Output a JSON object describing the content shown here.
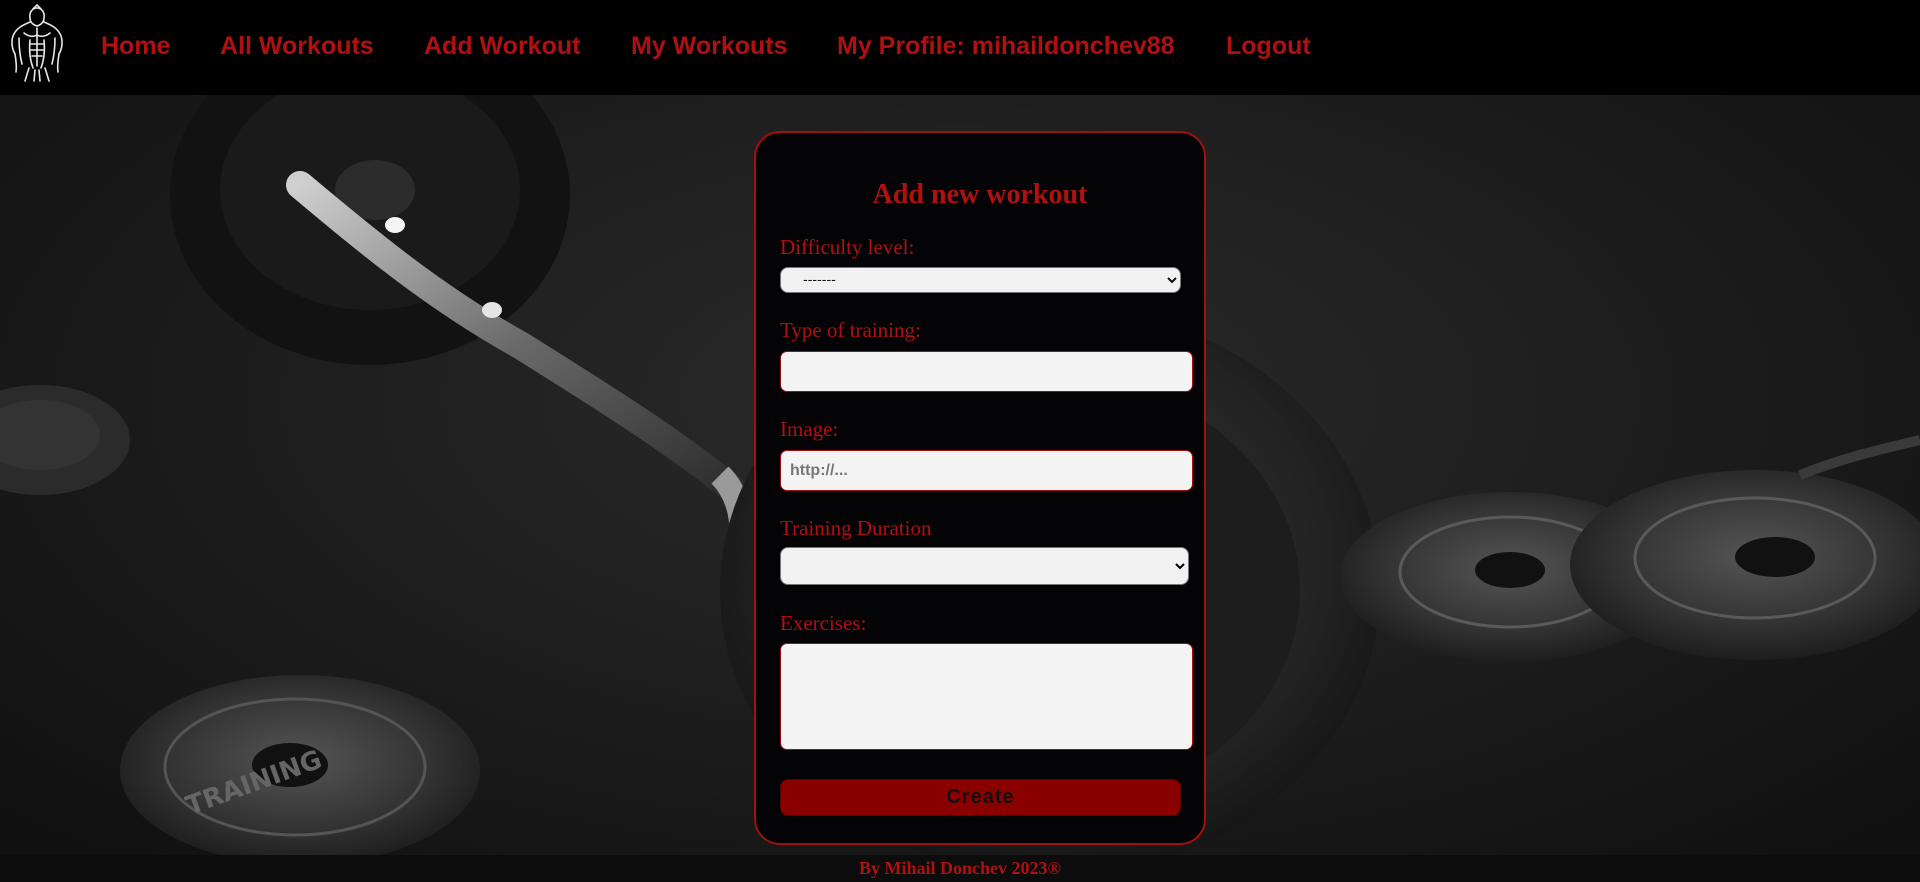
{
  "nav": {
    "logo_icon": "bodybuilder-logo-icon",
    "links": [
      {
        "label": "Home"
      },
      {
        "label": "All Workouts"
      },
      {
        "label": "Add Workout"
      },
      {
        "label": "My Workouts"
      },
      {
        "label": "My Profile: mihaildonchev88"
      },
      {
        "label": "Logout"
      }
    ]
  },
  "form": {
    "title": "Add new workout",
    "difficulty": {
      "label": "Difficulty level:",
      "selected": "-------"
    },
    "training_type": {
      "label": "Type of training:",
      "value": ""
    },
    "image": {
      "label": "Image:",
      "placeholder": "http://..."
    },
    "duration": {
      "label": "Training Duration",
      "selected": ""
    },
    "exercises": {
      "label": "Exercises:",
      "value": ""
    },
    "submit_label": "Create"
  },
  "footer": {
    "text": "By Mihail Donchev 2023®"
  },
  "colors": {
    "accent": "#b01010",
    "button": "#8a0000",
    "nav_bg": "#000000",
    "card_bg": "#040406"
  }
}
